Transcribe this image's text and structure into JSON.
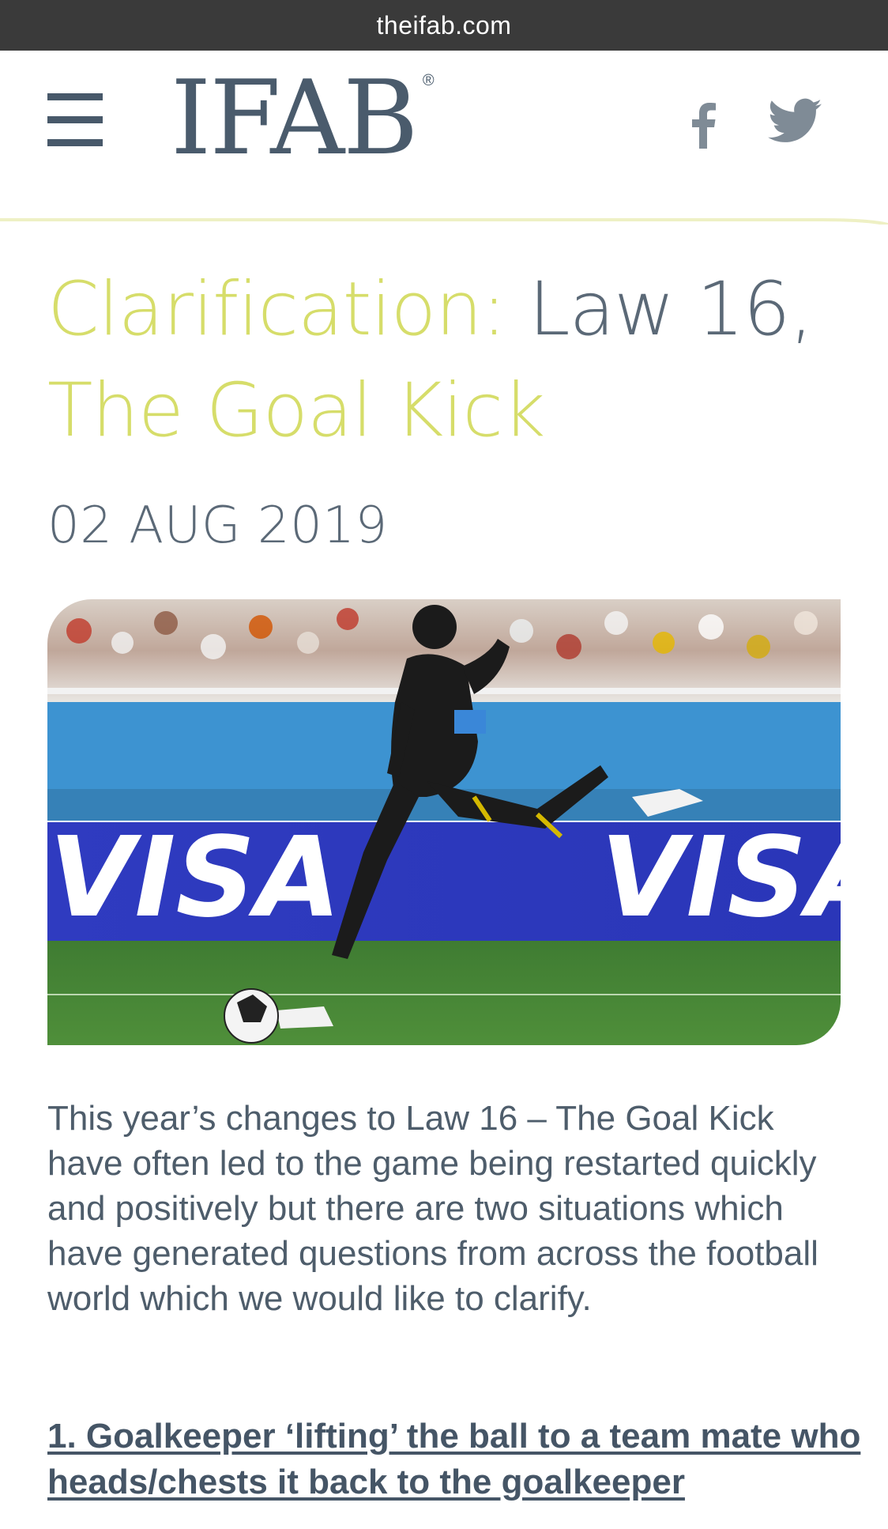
{
  "browser": {
    "url": "theifab.com"
  },
  "header": {
    "logo_text": "IFAB",
    "logo_mark": "®",
    "menu_icon": "hamburger-menu-icon",
    "social": [
      "facebook-icon",
      "twitter-icon"
    ]
  },
  "article": {
    "title_part1": "Clarification: ",
    "title_part2": "Law 16,",
    "title_part3": "The Goal Kick",
    "date": "02 AUG 2019",
    "hero_banner_text_left": "VISA",
    "hero_banner_text_right": "VISA",
    "body": "This year’s changes to Law 16 – The Goal Kick have often led to the game being restarted quickly and positively but there are two situations which have generated questions from across the football world which we would like to clarify.",
    "section_1": "1. Goalkeeper ‘lifting’ the ball to a team mate who heads/chests it back to the goalkeeper"
  },
  "colors": {
    "accent_yellow": "#d6dd6a",
    "slate": "#4a5b6c",
    "url_bar": "#3a3a3a"
  }
}
